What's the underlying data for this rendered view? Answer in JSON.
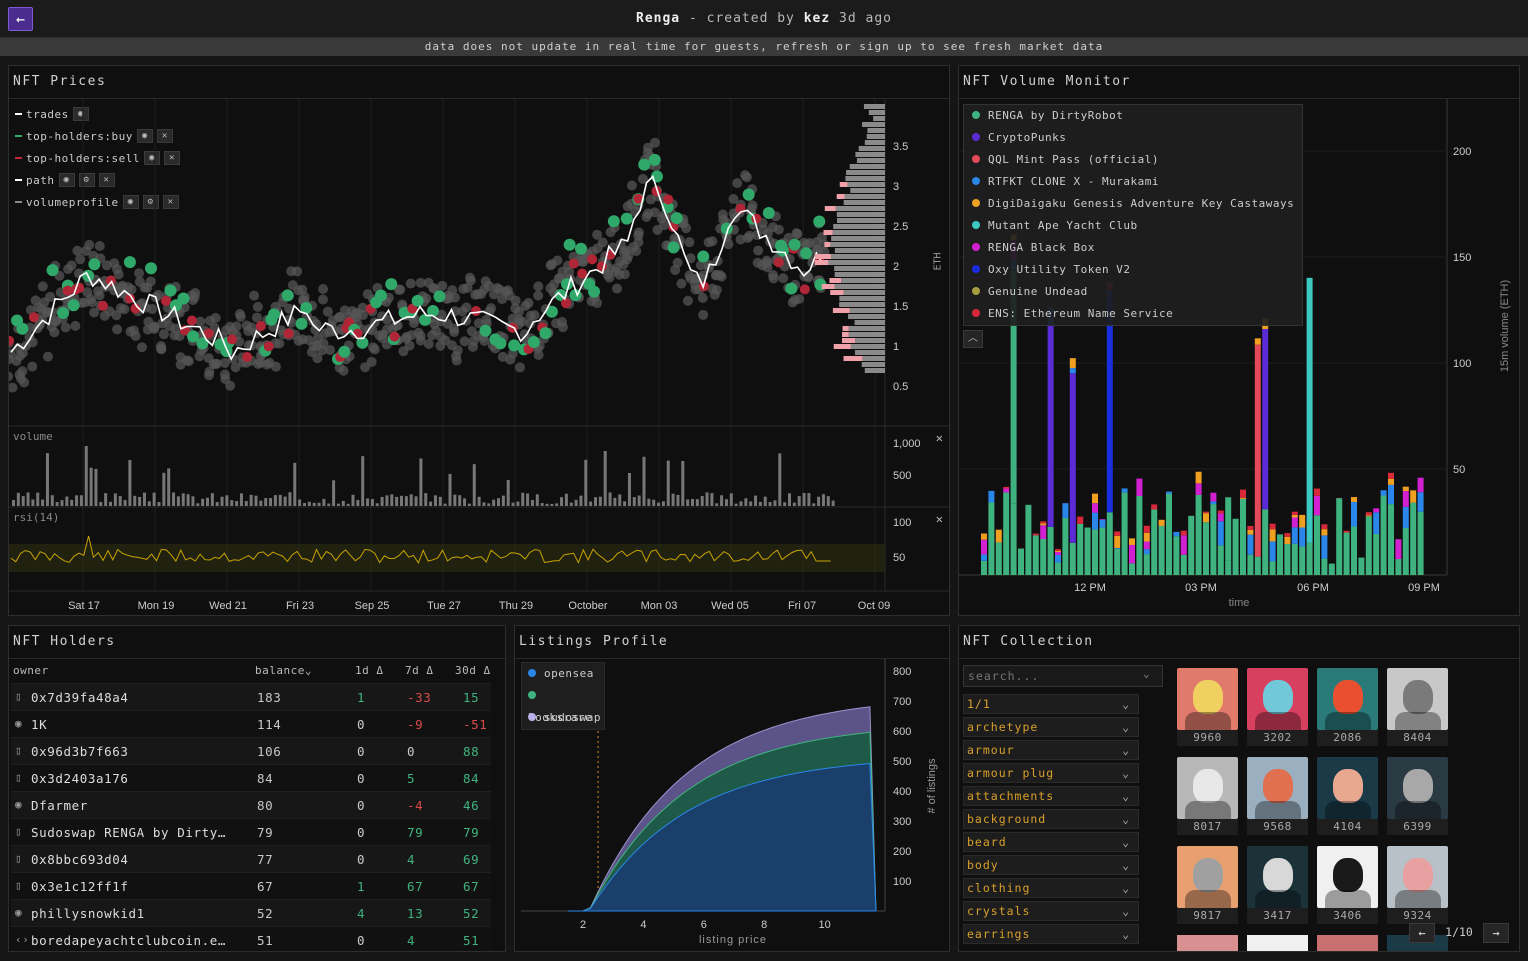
{
  "header": {
    "back_icon": "arrow-left-icon",
    "name": "Renga",
    "created_by": "- created by",
    "author": "kez",
    "ago": "3d ago"
  },
  "notice": "data does not update in real time for guests, refresh or sign up to see fresh market data",
  "prices": {
    "title": "NFT Prices",
    "legend": [
      {
        "label": "trades",
        "color": "#ffffff"
      },
      {
        "label": "top-holders:buy",
        "color": "#2fb06f"
      },
      {
        "label": "top-holders:sell",
        "color": "#c0283a"
      },
      {
        "label": "path",
        "color": "#ffffff"
      },
      {
        "label": "volumeprofile",
        "color": "#888888"
      }
    ],
    "y_ticks": [
      "3.5",
      "3",
      "2.5",
      "2",
      "1.5",
      "1",
      "0.5"
    ],
    "y_unit": "ETH",
    "volume_label": "volume",
    "volume_ticks": [
      "1,000",
      "500"
    ],
    "rsi_label": "rsi(14)",
    "rsi_ticks": [
      "100",
      "50"
    ],
    "x_ticks": [
      "Sat 17",
      "Mon 19",
      "Wed 21",
      "Fri 23",
      "Sep 25",
      "Tue 27",
      "Thu 29",
      "October",
      "Mon 03",
      "Wed 05",
      "Fri 07",
      "Oct 09"
    ],
    "close_icon": "close-icon"
  },
  "volume_monitor": {
    "title": "NFT Volume Monitor",
    "legend": [
      {
        "label": "RENGA by DirtyRobot",
        "color": "#3fb37f"
      },
      {
        "label": "CryptoPunks",
        "color": "#5b2bd6"
      },
      {
        "label": "QQL Mint Pass (official)",
        "color": "#e24a5a"
      },
      {
        "label": "RTFKT CLONE X - Murakami",
        "color": "#2a86e8"
      },
      {
        "label": "DigiDaigaku Genesis Adventure Key Castaways",
        "color": "#f0a020"
      },
      {
        "label": "Mutant Ape Yacht Club",
        "color": "#3cc8c0"
      },
      {
        "label": "RENGA Black Box",
        "color": "#d020d0"
      },
      {
        "label": "Oxy Utility Token V2",
        "color": "#1a2ee0"
      },
      {
        "label": "Genuine Undead",
        "color": "#a8a040"
      },
      {
        "label": "ENS: Ethereum Name Service",
        "color": "#d8283a"
      }
    ],
    "y_ticks": [
      "200",
      "150",
      "100",
      "50"
    ],
    "y_label": "15m volume (ETH)",
    "x_ticks": [
      "12 PM",
      "03 PM",
      "06 PM",
      "09 PM"
    ],
    "x_label": "time"
  },
  "holders": {
    "title": "NFT Holders",
    "columns": [
      "owner",
      "balance",
      "1d",
      "7d",
      "30d"
    ],
    "delta": "Δ",
    "rows": [
      {
        "icon": "document-icon",
        "owner": "0x7d39fa48a4",
        "balance": "183",
        "d1": "1",
        "d7": "-33",
        "d30": "15"
      },
      {
        "icon": "opensea-icon",
        "owner": "1K",
        "balance": "114",
        "d1": "0",
        "d7": "-9",
        "d30": "-51"
      },
      {
        "icon": "document-icon",
        "owner": "0x96d3b7f663",
        "balance": "106",
        "d1": "0",
        "d7": "0",
        "d30": "88"
      },
      {
        "icon": "document-icon",
        "owner": "0x3d2403a176",
        "balance": "84",
        "d1": "0",
        "d7": "5",
        "d30": "84"
      },
      {
        "icon": "opensea-icon",
        "owner": "Dfarmer",
        "balance": "80",
        "d1": "0",
        "d7": "-4",
        "d30": "46"
      },
      {
        "icon": "document-icon",
        "owner": "Sudoswap RENGA by Dirty…",
        "balance": "79",
        "d1": "0",
        "d7": "79",
        "d30": "79"
      },
      {
        "icon": "document-icon",
        "owner": "0x8bbc693d04",
        "balance": "77",
        "d1": "0",
        "d7": "4",
        "d30": "69"
      },
      {
        "icon": "document-icon",
        "owner": "0x3e1c12ff1f",
        "balance": "67",
        "d1": "1",
        "d7": "67",
        "d30": "67"
      },
      {
        "icon": "opensea-icon",
        "owner": "phillysnowkid1",
        "balance": "52",
        "d1": "4",
        "d7": "13",
        "d30": "52"
      },
      {
        "icon": "code-icon",
        "owner": "boredapeyachtclubcoin.e…",
        "balance": "51",
        "d1": "0",
        "d7": "4",
        "d30": "51"
      }
    ]
  },
  "listings": {
    "title": "Listings Profile",
    "legend": [
      {
        "label": "opensea",
        "color": "#2a86e8"
      },
      {
        "label": "looksrare",
        "color": "#3fb37f"
      },
      {
        "label": "sudoswap",
        "color": "#b8b0e8"
      }
    ],
    "y_ticks": [
      "800",
      "700",
      "600",
      "500",
      "400",
      "300",
      "200",
      "100"
    ],
    "y_label": "# of listings",
    "x_ticks": [
      "2",
      "4",
      "6",
      "8",
      "10"
    ],
    "x_label": "listing price"
  },
  "collection": {
    "title": "NFT Collection",
    "search_placeholder": "search...",
    "filters": [
      "1/1",
      "archetype",
      "armour",
      "armour plug",
      "attachments",
      "background",
      "beard",
      "body",
      "clothing",
      "crystals",
      "earrings"
    ],
    "items": [
      {
        "id": "9960",
        "bg": "#e07a6a",
        "fg": "#f0d060"
      },
      {
        "id": "3202",
        "bg": "#d84060",
        "fg": "#70c8d8"
      },
      {
        "id": "2086",
        "bg": "#2a7a7a",
        "fg": "#e85030"
      },
      {
        "id": "8404",
        "bg": "#c8c8c8",
        "fg": "#7a7a7a"
      },
      {
        "id": "8017",
        "bg": "#b8b8b8",
        "fg": "#e8e8e8"
      },
      {
        "id": "9568",
        "bg": "#9ab0c0",
        "fg": "#e07050"
      },
      {
        "id": "4104",
        "bg": "#1a3a48",
        "fg": "#e8a890"
      },
      {
        "id": "6399",
        "bg": "#2a3a42",
        "fg": "#a8a8a8"
      },
      {
        "id": "9817",
        "bg": "#e8a070",
        "fg": "#a0a0a0"
      },
      {
        "id": "3417",
        "bg": "#1a3238",
        "fg": "#d8d8d8"
      },
      {
        "id": "3406",
        "bg": "#f0f0f0",
        "fg": "#1a1a1a"
      },
      {
        "id": "9324",
        "bg": "#b8c0c8",
        "fg": "#e8a0a0"
      }
    ],
    "page": "1/10"
  }
}
